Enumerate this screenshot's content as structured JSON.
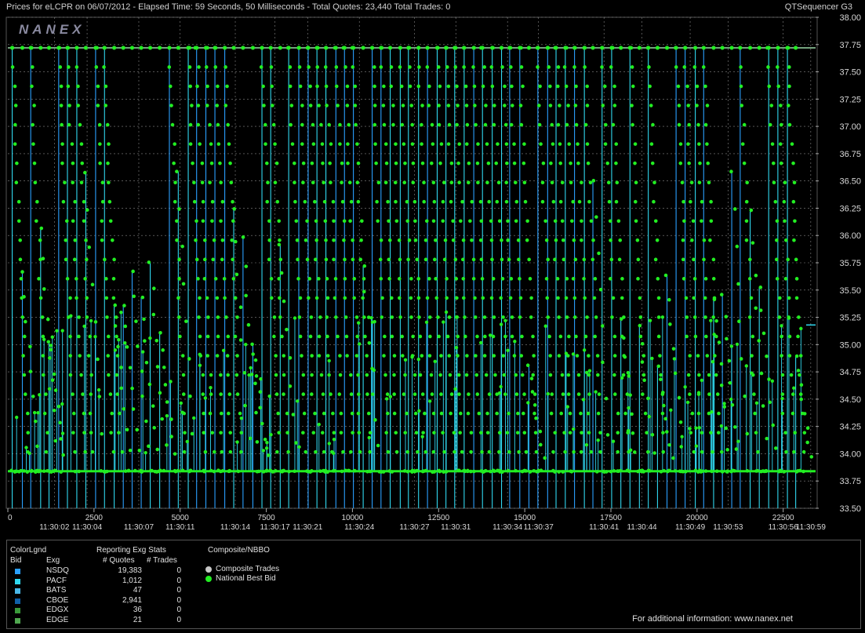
{
  "header": {
    "title": "Prices for  eLCPR  on  06/07/2012  -  Elapsed Time: 59 Seconds, 50 Milliseconds  -  Total Quotes: 23,440  Total Trades: 0",
    "app_name": "QTSequencer G3",
    "watermark": "NANEX"
  },
  "chart_data": {
    "type": "line",
    "title": "",
    "xlabel": "",
    "ylabel": "",
    "ylim": [
      33.5,
      38.0
    ],
    "xlim": [
      0,
      23440
    ],
    "y_ticks": [
      "38.00",
      "37.75",
      "37.50",
      "37.25",
      "37.00",
      "36.75",
      "36.50",
      "36.25",
      "36.00",
      "35.75",
      "35.50",
      "35.25",
      "35.00",
      "34.75",
      "34.50",
      "34.25",
      "34.00",
      "33.75",
      "33.50"
    ],
    "x_ticks": [
      {
        "value": 0,
        "label": "0"
      },
      {
        "value": 2500,
        "label": "2500"
      },
      {
        "value": 5000,
        "label": "5000"
      },
      {
        "value": 7500,
        "label": "7500"
      },
      {
        "value": 10000,
        "label": "10000"
      },
      {
        "value": 12500,
        "label": "12500"
      },
      {
        "value": 15000,
        "label": "15000"
      },
      {
        "value": 17500,
        "label": "17500"
      },
      {
        "value": 20000,
        "label": "20000"
      },
      {
        "value": 22500,
        "label": "22500"
      }
    ],
    "time_ticks": [
      {
        "value": 1350,
        "label": "11:30:02"
      },
      {
        "value": 2300,
        "label": "11:30:04"
      },
      {
        "value": 3800,
        "label": "11:30:07"
      },
      {
        "value": 5000,
        "label": "11:30:11"
      },
      {
        "value": 6600,
        "label": "11:30:14"
      },
      {
        "value": 7750,
        "label": "11:30:17"
      },
      {
        "value": 8700,
        "label": "11:30:21"
      },
      {
        "value": 10200,
        "label": "11:30:24"
      },
      {
        "value": 11800,
        "label": "11:30:27"
      },
      {
        "value": 13000,
        "label": "11:30:31"
      },
      {
        "value": 14500,
        "label": "11:30:34"
      },
      {
        "value": 15400,
        "label": "11:30:37"
      },
      {
        "value": 17300,
        "label": "11:30:41"
      },
      {
        "value": 18400,
        "label": "11:30:44"
      },
      {
        "value": 19800,
        "label": "11:30:49"
      },
      {
        "value": 20900,
        "label": "11:30:53"
      },
      {
        "value": 22500,
        "label": "11:30:56"
      },
      {
        "value": 23300,
        "label": "11:30:59"
      }
    ],
    "grid": true,
    "levels": {
      "top": 37.72,
      "bottom": 33.84,
      "last": 35.18
    },
    "series": [
      {
        "name": "National Best Bid",
        "color": "#22ee22"
      },
      {
        "name": "NSDQ",
        "color": "#2aa0ff"
      },
      {
        "name": "PACF",
        "color": "#30d8f0"
      }
    ]
  },
  "legend": {
    "headings": {
      "color": "ColorLgnd",
      "bid": "Bid",
      "exg": "Exg",
      "stats": "Reporting Exg Stats",
      "quotes": "# Quotes",
      "trades": "# Trades",
      "composite": "Composite/NBBO"
    },
    "exchanges": [
      {
        "name": "NSDQ",
        "quotes": "19,383",
        "trades": "0",
        "color": "#2aa0ff"
      },
      {
        "name": "PACF",
        "quotes": "1,012",
        "trades": "0",
        "color": "#30d8f0"
      },
      {
        "name": "BATS",
        "quotes": "47",
        "trades": "0",
        "color": "#4ab8e8"
      },
      {
        "name": "CBOE",
        "quotes": "2,941",
        "trades": "0",
        "color": "#1060a8"
      },
      {
        "name": "EDGX",
        "quotes": "36",
        "trades": "0",
        "color": "#3a9a3a"
      },
      {
        "name": "EDGE",
        "quotes": "21",
        "trades": "0",
        "color": "#50a850"
      }
    ],
    "composite_items": [
      {
        "label": "Composite Trades",
        "color": "#c8c8c8"
      },
      {
        "label": "National Best Bid",
        "color": "#22ee22"
      }
    ],
    "footer": "For additional information: www.nanex.net"
  }
}
